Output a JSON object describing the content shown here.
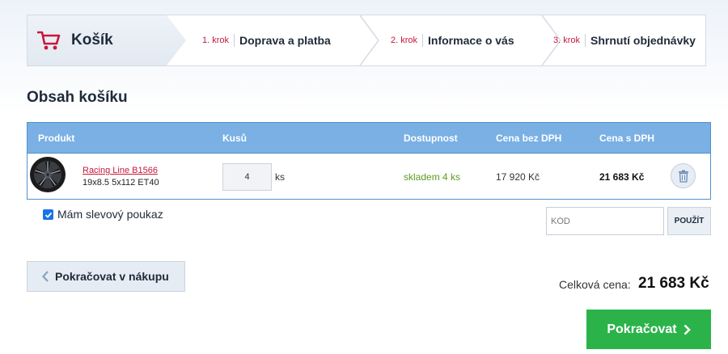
{
  "steps": {
    "cart_label": "Košík",
    "items": [
      {
        "num": "1. krok",
        "label": "Doprava a platba"
      },
      {
        "num": "2. krok",
        "label": "Informace o vás"
      },
      {
        "num": "3. krok",
        "label": "Shrnutí objednávky"
      }
    ]
  },
  "page_title": "Obsah košíku",
  "table": {
    "headers": [
      "Produkt",
      "Kusů",
      "Dostupnost",
      "Cena bez DPH",
      "Cena s DPH"
    ],
    "rows": [
      {
        "name": "Racing Line B1566",
        "spec": "19x8.5 5x112 ET40",
        "qty": "4",
        "unit": "ks",
        "availability": "skladem 4 ks",
        "price_net": "17 920 Kč",
        "price_gross": "21 683 Kč"
      }
    ]
  },
  "voucher": {
    "label": "Mám slevový poukaz",
    "checked": true,
    "placeholder": "KÓD",
    "apply_label": "POUŽÍT"
  },
  "continue_shopping_label": "Pokračovat v nákupu",
  "total": {
    "label": "Celková cena:",
    "value": "21 683 Kč"
  },
  "checkout_label": "Pokračovat",
  "colors": {
    "accent_red": "#c7183a",
    "table_header": "#7ab0e4",
    "stock_green": "#5f9a23",
    "checkout_green": "#2bb34a"
  }
}
